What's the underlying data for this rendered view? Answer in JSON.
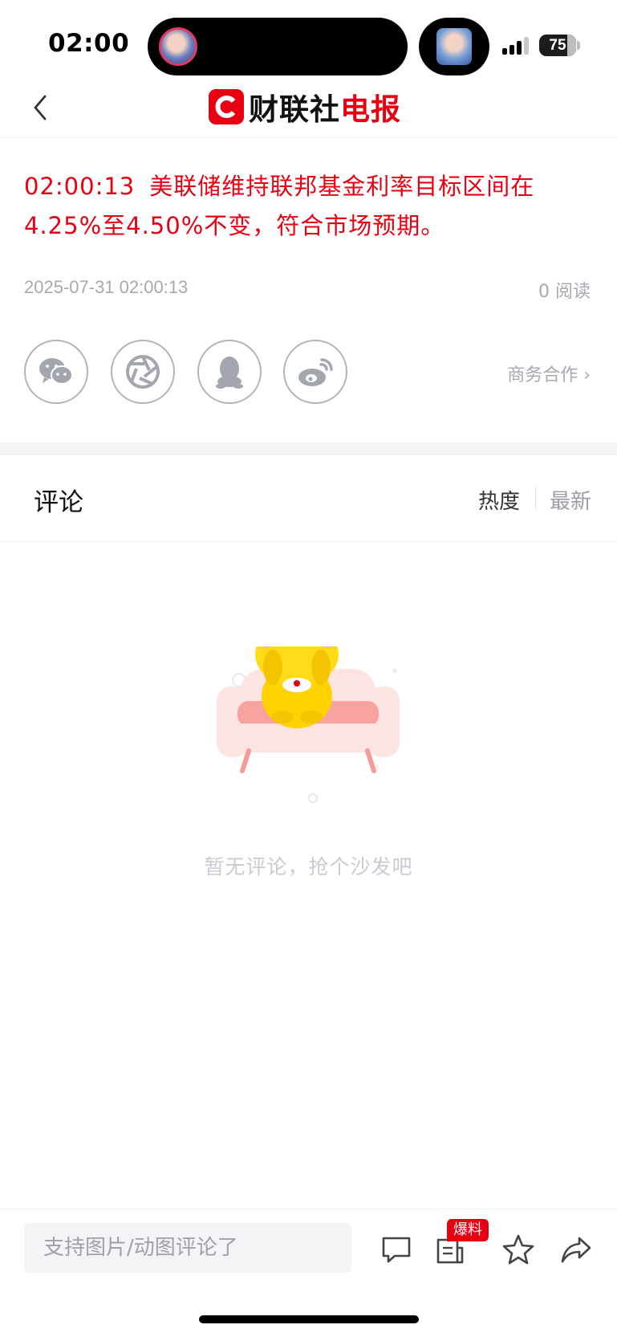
{
  "status_bar": {
    "time": "02:00",
    "battery": "75",
    "battery_level": 0.75
  },
  "nav": {
    "back_icon": "chevron-left-icon",
    "logo_mark": "C",
    "logo_black": "财联社",
    "logo_red": "电报"
  },
  "article": {
    "time": "02:00:13",
    "headline": "美联储维持联邦基金利率目标区间在4.25%至4.50%不变，符合市场预期。",
    "date": "2025-07-31 02:00:13",
    "reads": "0 阅读",
    "share_icons": [
      "wechat-icon",
      "moments-icon",
      "qq-icon",
      "weibo-icon"
    ],
    "business": "商务合作 ›"
  },
  "comments": {
    "title": "评论",
    "sort_hot": "热度",
    "sort_new": "最新",
    "empty_text": "暂无评论，抢个沙发吧"
  },
  "bottom_bar": {
    "input_placeholder": "支持图片/动图评论了",
    "badge": "爆料",
    "icons": [
      "comment-icon",
      "report-icon",
      "star-icon",
      "share-icon"
    ]
  },
  "colors": {
    "brand_red": "#e60012",
    "muted_gray": "#a6a9b0"
  }
}
